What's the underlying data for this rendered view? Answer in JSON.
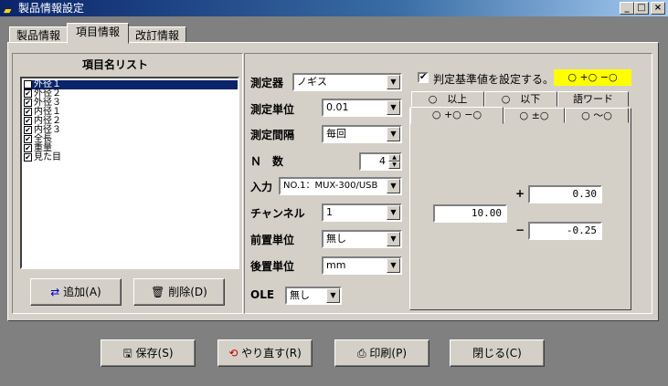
{
  "window": {
    "title": "製品情報設定",
    "minimize": "_",
    "maximize": "□",
    "close": "×"
  },
  "tabs": [
    {
      "label": "製品情報",
      "selected": false
    },
    {
      "label": "項目情報",
      "selected": true
    },
    {
      "label": "改訂情報",
      "selected": false
    }
  ],
  "item_list": {
    "title": "項目名リスト",
    "items": [
      {
        "label": "外径１",
        "checked": true,
        "selected": true
      },
      {
        "label": "外径２",
        "checked": true
      },
      {
        "label": "外径３",
        "checked": true
      },
      {
        "label": "内径１",
        "checked": true
      },
      {
        "label": "内径２",
        "checked": true
      },
      {
        "label": "内径３",
        "checked": true
      },
      {
        "label": "全長",
        "checked": true
      },
      {
        "label": "重量",
        "checked": true
      },
      {
        "label": "見た目",
        "checked": true
      }
    ],
    "add_button": "追加(A)",
    "delete_button": "削除(D)"
  },
  "settings": {
    "instrument": {
      "label": "測定器",
      "value": "ノギス"
    },
    "unit": {
      "label": "測定単位",
      "value": "0.01"
    },
    "interval": {
      "label": "測定間隔",
      "value": "毎回"
    },
    "n_count": {
      "label": "Ｎ　数",
      "value": "4"
    },
    "input": {
      "label": "入力",
      "value": "NO.1：MUX-300/USB"
    },
    "channel": {
      "label": "チャンネル",
      "value": "1"
    },
    "pre_unit": {
      "label": "前置単位",
      "value": "無し"
    },
    "post_unit": {
      "label": "後置単位",
      "value": "mm"
    },
    "ole": {
      "label": "OLE",
      "value": "無し"
    }
  },
  "judgement": {
    "checkbox_label": "判定基準値を設定する。",
    "checked": true,
    "badge": "○ +○ −○",
    "badge_color": "#ffff00",
    "tabs_row1": [
      "○　以上",
      "○　以下",
      "語ワード"
    ],
    "tabs_row2": [
      "○ +○ −○",
      "○ ±○",
      "○ ～○"
    ],
    "active_tab": "○ +○ −○",
    "plus_sign": "+",
    "minus_sign": "−",
    "nominal": "10.00",
    "upper": "0.30",
    "lower": "-0.25"
  },
  "bottom_buttons": {
    "save": "保存(S)",
    "redo": "やり直す(R)",
    "print": "印刷(P)",
    "close": "閉じる(C)"
  }
}
